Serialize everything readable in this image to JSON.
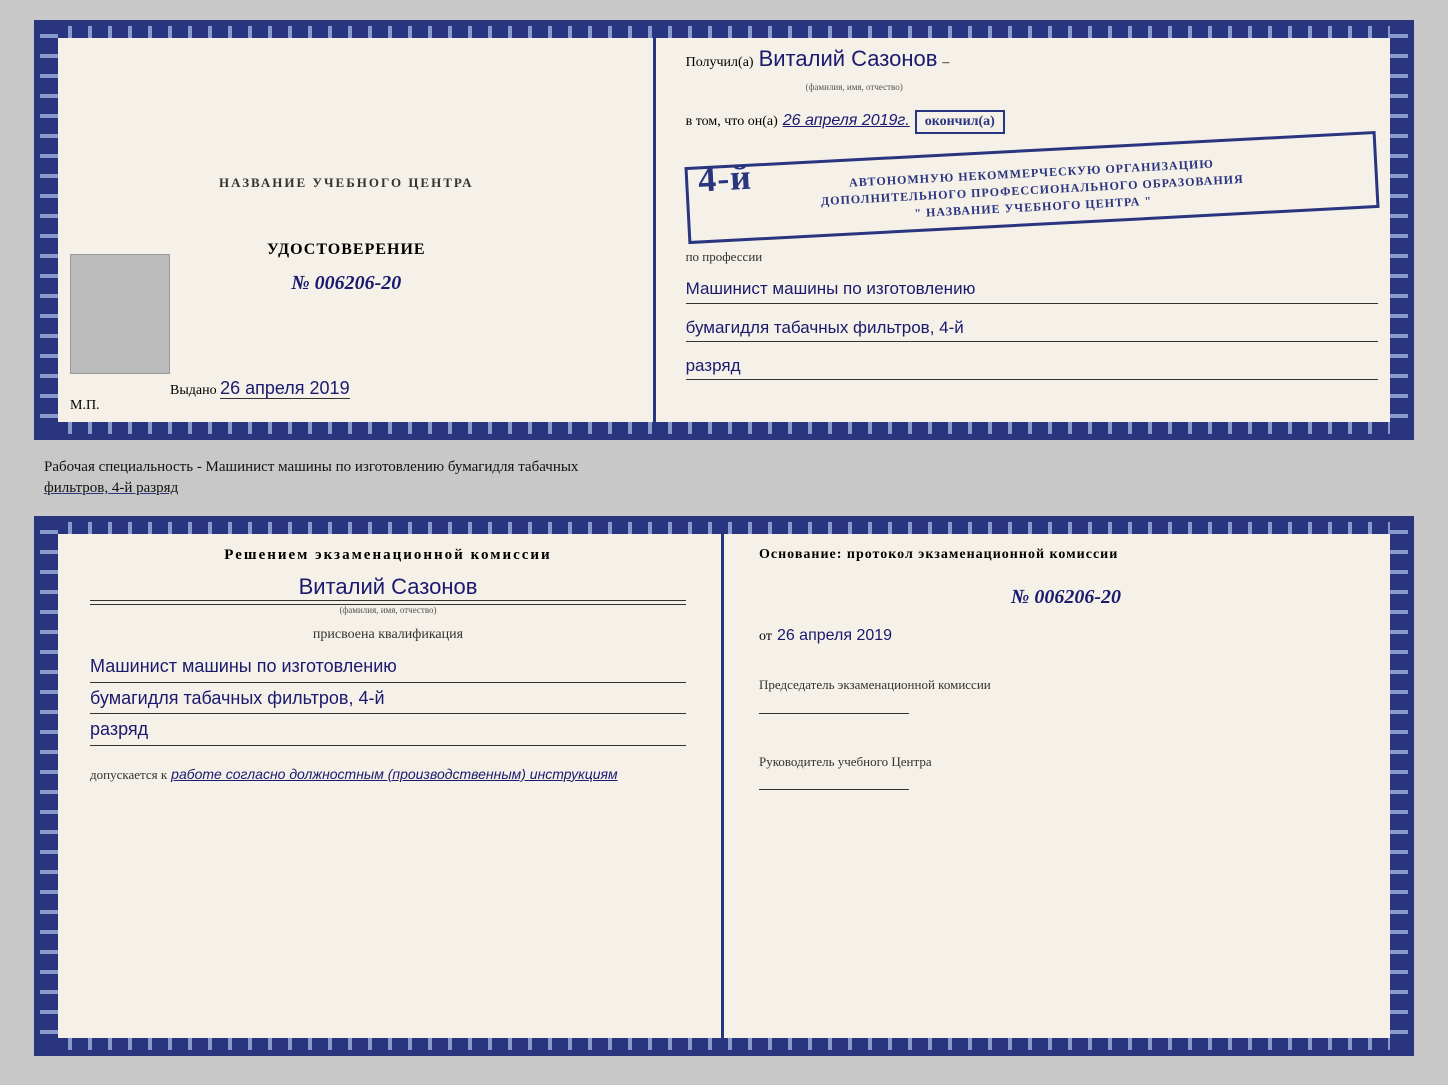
{
  "top_cert": {
    "left": {
      "school_label": "НАЗВАНИЕ УЧЕБНОГО ЦЕНТРА",
      "udost_title": "УДОСТОВЕРЕНИЕ",
      "udost_number": "№ 006206-20",
      "vydano_label": "Выдано",
      "vydano_date": "26 апреля 2019",
      "mp_label": "М.П."
    },
    "right": {
      "poluchil_prefix": "Получил(а)",
      "recipient_name": "Виталий Сазонов",
      "fio_label": "(фамилия, имя, отчество)",
      "dash": "–",
      "vtom_prefix": "в том, что он(а)",
      "vtom_date": "26 апреля 2019г.",
      "okonchil": "окончил(а)",
      "stamp_number": "4-й",
      "stamp_line1": "АВТОНОМНУЮ НЕКОММЕРЧЕСКУЮ ОРГАНИЗАЦИЮ",
      "stamp_line2": "ДОПОЛНИТЕЛЬНОГО ПРОФЕССИОНАЛЬНОГО ОБРАЗОВАНИЯ",
      "stamp_line3": "\" НАЗВАНИЕ УЧЕБНОГО ЦЕНТРА \"",
      "po_professii": "по профессии",
      "profession_line1": "Машинист машины по изготовлению",
      "profession_line2": "бумагидля табачных фильтров, 4-й",
      "profession_line3": "разряд"
    }
  },
  "separator": {
    "text": "Рабочая специальность - Машинист машины по изготовлению бумагидля табачных",
    "underline_text": "фильтров, 4-й разряд"
  },
  "bottom_cert": {
    "left": {
      "resheniem_title": "Решением экзаменационной комиссии",
      "name": "Виталий Сазонов",
      "fio_label": "(фамилия, имя, отчество)",
      "prisvoena": "присвоена квалификация",
      "kvali_line1": "Машинист машины по изготовлению",
      "kvali_line2": "бумагидля табачных фильтров, 4-й",
      "kvali_line3": "разряд",
      "dopusk_prefix": "допускается к",
      "dopusk_text": "работе согласно должностным (производственным) инструкциям"
    },
    "right": {
      "osnovanie": "Основание: протокол экзаменационной  комиссии",
      "protocol_number": "№  006206-20",
      "ot_prefix": "от",
      "ot_date": "26 апреля 2019",
      "predsedatel_label": "Председатель экзаменационной комиссии",
      "rukovoditel_label": "Руководитель учебного Центра"
    }
  }
}
